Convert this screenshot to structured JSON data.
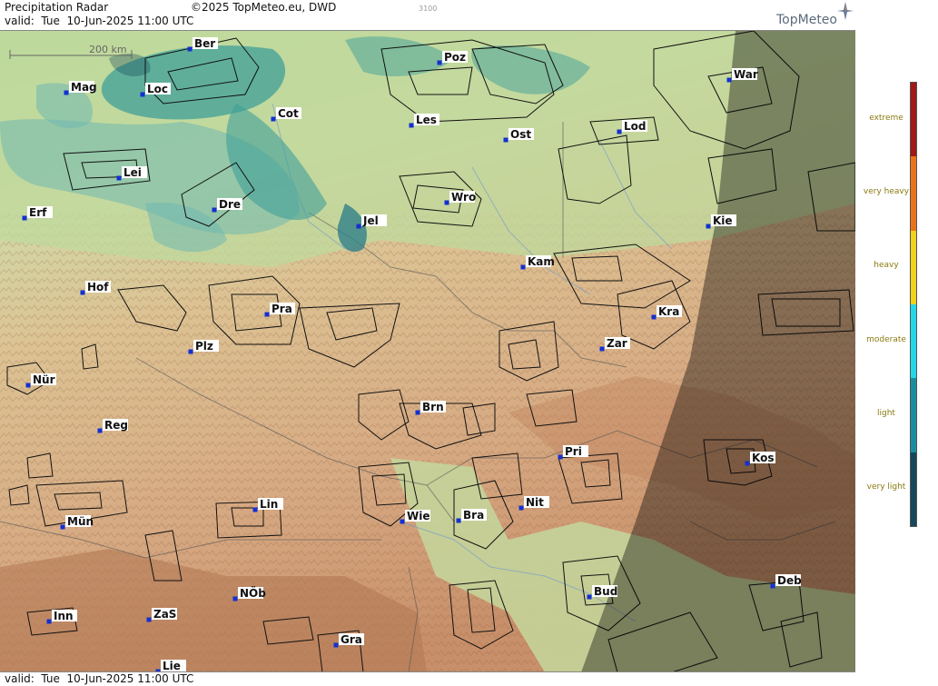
{
  "header": {
    "title": "Precipitation Radar",
    "copyright": "©2025 TopMeteo.eu, DWD",
    "code": "3100",
    "valid": "valid:  Tue  10-Jun-2025 11:00 UTC",
    "brand": "TopMeteo"
  },
  "footer": {
    "valid": "valid:  Tue  10-Jun-2025 11:00 UTC"
  },
  "scale": {
    "label": "200 km"
  },
  "cities": [
    {
      "name": "Ber"
    },
    {
      "name": "Poz"
    },
    {
      "name": "War"
    },
    {
      "name": "Mag"
    },
    {
      "name": "Loc"
    },
    {
      "name": "Cot"
    },
    {
      "name": "Les"
    },
    {
      "name": "Ost"
    },
    {
      "name": "Lod"
    },
    {
      "name": "Lei"
    },
    {
      "name": "Dre"
    },
    {
      "name": "Wro"
    },
    {
      "name": "Erf"
    },
    {
      "name": "Jel"
    },
    {
      "name": "Kie"
    },
    {
      "name": "Kam"
    },
    {
      "name": "Hof"
    },
    {
      "name": "Pra"
    },
    {
      "name": "Kra"
    },
    {
      "name": "Plz"
    },
    {
      "name": "Zar"
    },
    {
      "name": "Nür"
    },
    {
      "name": "Brn"
    },
    {
      "name": "Reg"
    },
    {
      "name": "Pri"
    },
    {
      "name": "Kos"
    },
    {
      "name": "Nit"
    },
    {
      "name": "Lin"
    },
    {
      "name": "Wie"
    },
    {
      "name": "Bra"
    },
    {
      "name": "Mün"
    },
    {
      "name": "Bud"
    },
    {
      "name": "Deb"
    },
    {
      "name": "NÖb"
    },
    {
      "name": "ZaS"
    },
    {
      "name": "Inn"
    },
    {
      "name": "Gra"
    },
    {
      "name": "Lie"
    }
  ],
  "legend": {
    "items": [
      {
        "label": "extreme",
        "color": "#a01818"
      },
      {
        "label": "very heavy",
        "color": "#e8741a"
      },
      {
        "label": "heavy",
        "color": "#f2d21a"
      },
      {
        "label": "moderate",
        "color": "#22d8e8"
      },
      {
        "label": "light",
        "color": "#1a8ea0"
      },
      {
        "label": "very light",
        "color": "#14485a"
      }
    ]
  },
  "colors": {
    "lowland": "#c9d8a2",
    "hills": "#d9b98a",
    "mountains": "#c98a5a",
    "precip_light": "#3f9f9a",
    "precip_verylight": "#6fb8b0",
    "city_dot": "#1430d0",
    "night_shade": "#000000"
  }
}
